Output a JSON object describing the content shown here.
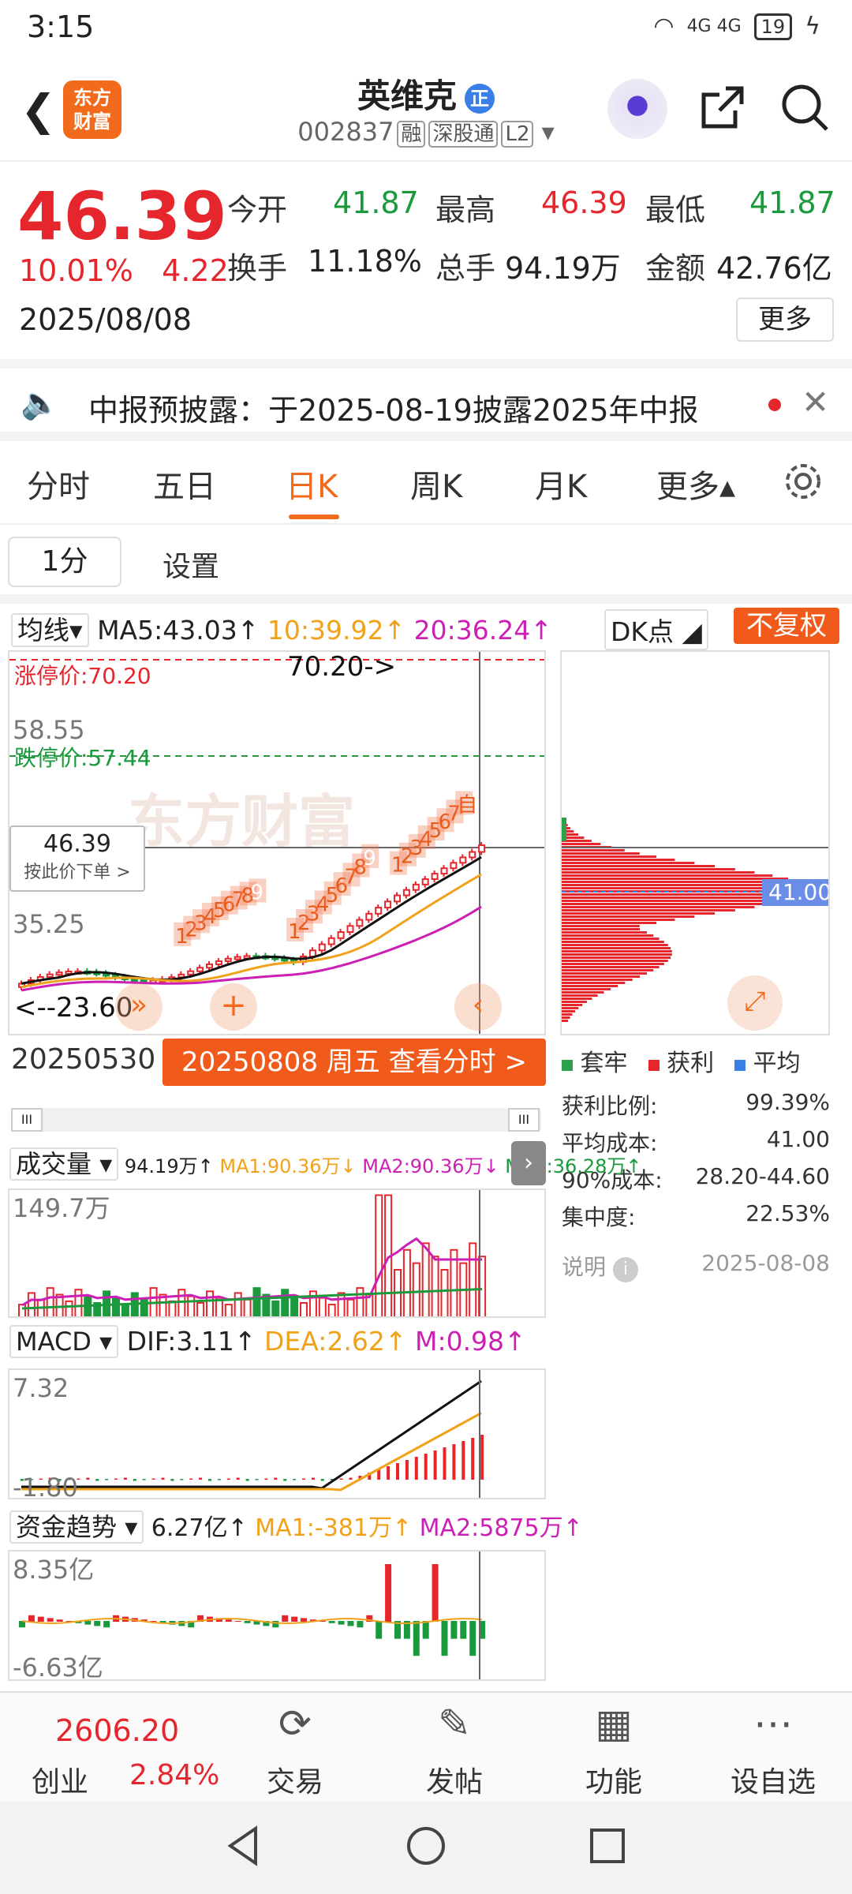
{
  "status": {
    "time": "3:15",
    "signal": "4G 4G",
    "battery": "19"
  },
  "header": {
    "logo_text": "东方\n财富",
    "name": "英维克",
    "badge": "正",
    "code": "002837",
    "tags": [
      "融",
      "深股通",
      "L2"
    ]
  },
  "quote": {
    "price": "46.39",
    "change_pct": "10.01%",
    "change": "4.22",
    "date": "2025/08/08",
    "open_label": "今开",
    "open": "41.87",
    "high_label": "最高",
    "high": "46.39",
    "low_label": "最低",
    "low": "41.87",
    "turnover_label": "换手",
    "turnover": "11.18%",
    "volume_label": "总手",
    "volume": "94.19万",
    "amount_label": "金额",
    "amount": "42.76亿",
    "more": "更多"
  },
  "notice": {
    "text": "中报预披露：于2025-08-19披露2025年中报"
  },
  "tabs": [
    "分时",
    "五日",
    "日K",
    "周K",
    "月K",
    "更多▴"
  ],
  "subbar": {
    "period": "1分",
    "settings": "设置"
  },
  "kline": {
    "ma_select": "均线",
    "ma5": "MA5:43.03↑",
    "ma10": "10:39.92↑",
    "ma20": "20:36.24↑",
    "dk": "DK点",
    "fuquan": "不复权",
    "limit_up": "涨停价:70.20",
    "limit_down": "跌停价:57.44",
    "arrow_label": "70.20->",
    "y_labels": [
      "58.55",
      "35.25",
      "23.60"
    ],
    "low_label": "<--23.60",
    "cursor_price": "46.39",
    "cursor_hint": "按此价下单 >",
    "start_date": "20250530",
    "end_date_btn": "20250808 周五 查看分时 >",
    "watermark": "东方财富",
    "signals_a": [
      "1",
      "2",
      "3",
      "4",
      "5",
      "6",
      "7",
      "8",
      "9"
    ],
    "signals_b": [
      "1",
      "2",
      "3",
      "4",
      "5",
      "6",
      "7",
      "8",
      "9"
    ],
    "signals_c": [
      "1",
      "2",
      "3",
      "4",
      "5",
      "6",
      "7",
      "自"
    ],
    "chip_price": "41.00"
  },
  "chips": {
    "legend": [
      "套牢",
      "获利",
      "平均"
    ],
    "rows": [
      {
        "label": "获利比例:",
        "value": "99.39%"
      },
      {
        "label": "平均成本:",
        "value": "41.00"
      },
      {
        "label": "90%成本:",
        "value": "28.20-44.60"
      },
      {
        "label": "集中度:",
        "value": "22.53%"
      }
    ],
    "note": "说明",
    "note_date": "2025-08-08"
  },
  "volume": {
    "select": "成交量",
    "v": "94.19万↑",
    "ma1": "MA1:90.36万↓",
    "ma2": "MA2:90.36万↓",
    "ma3": "MA3:36.28万↑",
    "ymax": "149.7万"
  },
  "macd": {
    "select": "MACD",
    "dif": "DIF:3.11↑",
    "dea": "DEA:2.62↑",
    "m": "M:0.98↑",
    "ytop": "7.32",
    "ybot": "-1.80"
  },
  "fund": {
    "select": "资金趋势",
    "v": "6.27亿↑",
    "ma1": "MA1:-381万↑",
    "ma2": "MA2:5875万↑",
    "ytop": "8.35亿",
    "ybot": "-6.63亿"
  },
  "bottom": {
    "index_value": "2606.20",
    "index_name": "创业",
    "index_pct": "2.84%",
    "items": [
      "交易",
      "发帖",
      "功能",
      "设自选"
    ]
  },
  "colors": {
    "accent": "#f26a1b",
    "up": "#e5262c",
    "down": "#1a9a3c",
    "ma10": "#f0a21a",
    "ma20": "#cc1fb4"
  }
}
